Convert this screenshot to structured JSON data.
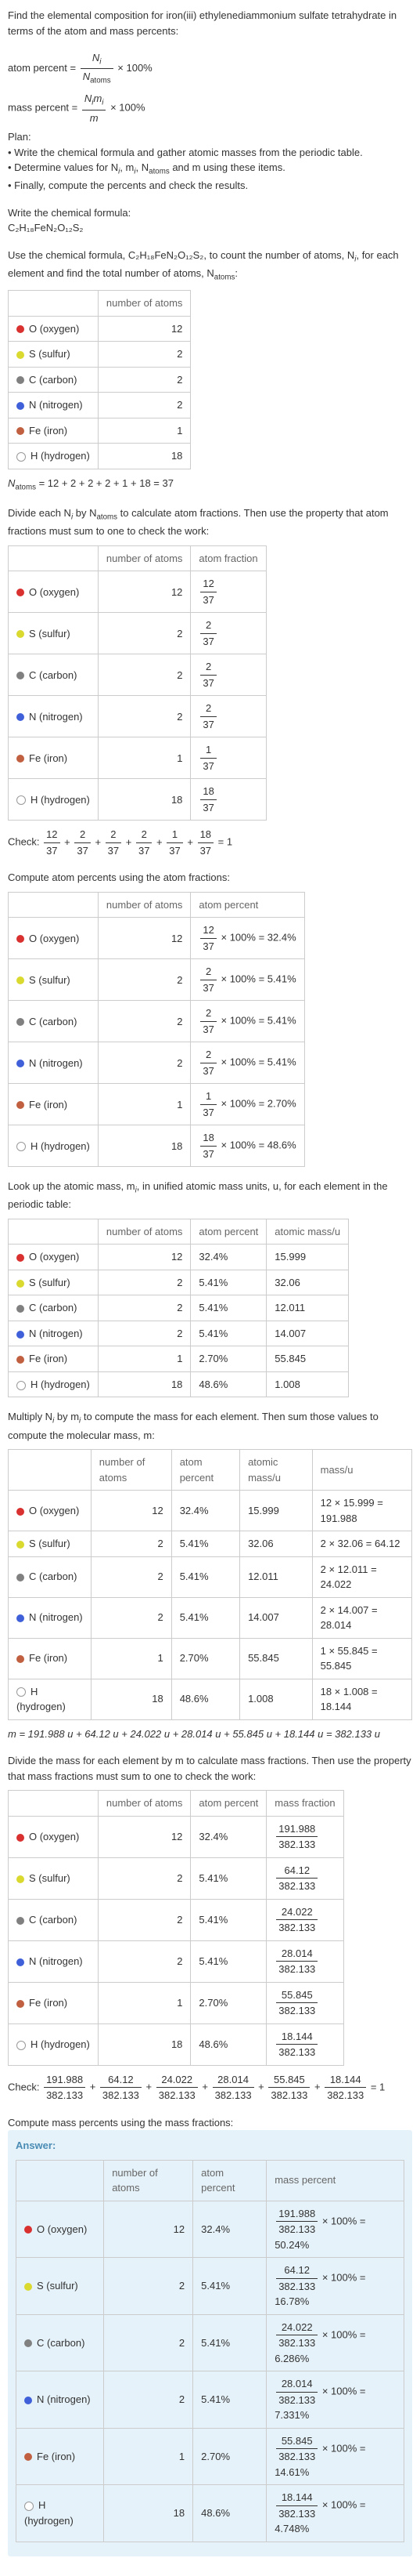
{
  "title": "Find the elemental composition for iron(iii) ethylenediammonium sulfate tetrahydrate in terms of the atom and mass percents:",
  "f1_label": "atom percent =",
  "f1_num": "N",
  "f1_num_sub": "i",
  "f1_den": "N",
  "f1_den_sub": "atoms",
  "times100": "× 100%",
  "f2_label": "mass percent =",
  "f2_num": "N",
  "f2_num_sub": "i",
  "f2_num2": "m",
  "f2_num2_sub": "i",
  "f2_den": "m",
  "plan_label": "Plan:",
  "plan1": "• Write the chemical formula and gather atomic masses from the periodic table.",
  "plan2": "• Determine values for N",
  "plan2b": ", m",
  "plan2c": ", N",
  "plan2d": " and m using these items.",
  "plan3": "• Finally, compute the percents and check the results.",
  "wc": "Write the chemical formula:",
  "cf": "C₂H₁₈FeN₂O₁₂S₂",
  "use": "Use the chemical formula, C₂H₁₈FeN₂O₁₂S₂, to count the number of atoms, N",
  "use2": ", for each element and find the total number of atoms, N",
  "use3": ":",
  "h_noa": "number of atoms",
  "h_af": "atom fraction",
  "h_ap": "atom percent",
  "h_am": "atomic mass/u",
  "h_mu": "mass/u",
  "h_mf": "mass fraction",
  "h_mp": "mass percent",
  "elements": [
    {
      "name": "O (oxygen)",
      "color": "#d93030",
      "n": "12",
      "af_n": "12",
      "af_d": "37",
      "ap": "32.4%",
      "ap_calc": "× 100% = 32.4%",
      "am": "15.999",
      "mu": "12 × 15.999 = 191.988",
      "mf_n": "191.988",
      "mf_d": "382.133",
      "mp_n": "191.988",
      "mp_d": "382.133",
      "mp": "× 100% = 50.24%"
    },
    {
      "name": "S (sulfur)",
      "color": "#d9d930",
      "n": "2",
      "af_n": "2",
      "af_d": "37",
      "ap": "5.41%",
      "ap_calc": "× 100% = 5.41%",
      "am": "32.06",
      "mu": "2 × 32.06 = 64.12",
      "mf_n": "64.12",
      "mf_d": "382.133",
      "mp_n": "64.12",
      "mp_d": "382.133",
      "mp": "× 100% = 16.78%"
    },
    {
      "name": "C (carbon)",
      "color": "#808080",
      "n": "2",
      "af_n": "2",
      "af_d": "37",
      "ap": "5.41%",
      "ap_calc": "× 100% = 5.41%",
      "am": "12.011",
      "mu": "2 × 12.011 = 24.022",
      "mf_n": "24.022",
      "mf_d": "382.133",
      "mp_n": "24.022",
      "mp_d": "382.133",
      "mp": "× 100% = 6.286%"
    },
    {
      "name": "N (nitrogen)",
      "color": "#4060d9",
      "n": "2",
      "af_n": "2",
      "af_d": "37",
      "ap": "5.41%",
      "ap_calc": "× 100% = 5.41%",
      "am": "14.007",
      "mu": "2 × 14.007 = 28.014",
      "mf_n": "28.014",
      "mf_d": "382.133",
      "mp_n": "28.014",
      "mp_d": "382.133",
      "mp": "× 100% = 7.331%"
    },
    {
      "name": "Fe (iron)",
      "color": "#c06040",
      "n": "1",
      "af_n": "1",
      "af_d": "37",
      "ap": "2.70%",
      "ap_calc": "× 100% = 2.70%",
      "am": "55.845",
      "mu": "1 × 55.845 = 55.845",
      "mf_n": "55.845",
      "mf_d": "382.133",
      "mp_n": "55.845",
      "mp_d": "382.133",
      "mp": "× 100% = 14.61%"
    },
    {
      "name": "H (hydrogen)",
      "color": "#ffffff",
      "n": "18",
      "af_n": "18",
      "af_d": "37",
      "ap": "48.6%",
      "ap_calc": "× 100% = 48.6%",
      "am": "1.008",
      "mu": "18 × 1.008 = 18.144",
      "mf_n": "18.144",
      "mf_d": "382.133",
      "mp_n": "18.144",
      "mp_d": "382.133",
      "mp": "× 100% = 4.748%"
    }
  ],
  "natoms": "N",
  "natoms_eq": " = 12 + 2 + 2 + 2 + 1 + 18 = 37",
  "divide": "Divide each N",
  "divide2": " by N",
  "divide3": " to calculate atom fractions. Then use the property that atom fractions must sum to one to check the work:",
  "check": "Check: ",
  "check_eq": " = 1",
  "cap_atoms": "Compute atom percents using the atom fractions:",
  "look": "Look up the atomic mass, m",
  "look2": ", in unified atomic mass units, u, for each element in the periodic table:",
  "mult": "Multiply N",
  "mult2": " by m",
  "mult3": " to compute the mass for each element. Then sum those values to compute the molecular mass, m:",
  "m_eq": "m = 191.988 u + 64.12 u + 24.022 u + 28.014 u + 55.845 u + 18.144 u = 382.133 u",
  "div_mass": "Divide the mass for each element by m to calculate mass fractions. Then use the property that mass fractions must sum to one to check the work:",
  "cmp": "Compute mass percents using the mass fractions:",
  "answer": "Answer:",
  "chart_data": {
    "type": "table",
    "tables": [
      {
        "title": "atom counts",
        "rows": [
          [
            "O (oxygen)",
            12
          ],
          [
            "S (sulfur)",
            2
          ],
          [
            "C (carbon)",
            2
          ],
          [
            "N (nitrogen)",
            2
          ],
          [
            "Fe (iron)",
            1
          ],
          [
            "H (hydrogen)",
            18
          ]
        ],
        "N_atoms": 37
      },
      {
        "title": "atom fractions",
        "rows": [
          [
            "O",
            "12/37"
          ],
          [
            "S",
            "2/37"
          ],
          [
            "C",
            "2/37"
          ],
          [
            "N",
            "2/37"
          ],
          [
            "Fe",
            "1/37"
          ],
          [
            "H",
            "18/37"
          ]
        ]
      },
      {
        "title": "atom percents",
        "rows": [
          [
            "O",
            32.4
          ],
          [
            "S",
            5.41
          ],
          [
            "C",
            5.41
          ],
          [
            "N",
            5.41
          ],
          [
            "Fe",
            2.7
          ],
          [
            "H",
            48.6
          ]
        ]
      },
      {
        "title": "atomic mass/u",
        "rows": [
          [
            "O",
            15.999
          ],
          [
            "S",
            32.06
          ],
          [
            "C",
            12.011
          ],
          [
            "N",
            14.007
          ],
          [
            "Fe",
            55.845
          ],
          [
            "H",
            1.008
          ]
        ]
      },
      {
        "title": "mass/u",
        "rows": [
          [
            "O",
            191.988
          ],
          [
            "S",
            64.12
          ],
          [
            "C",
            24.022
          ],
          [
            "N",
            28.014
          ],
          [
            "Fe",
            55.845
          ],
          [
            "H",
            18.144
          ]
        ],
        "m": 382.133
      },
      {
        "title": "mass fractions",
        "rows": [
          [
            "O",
            "191.988/382.133"
          ],
          [
            "S",
            "64.12/382.133"
          ],
          [
            "C",
            "24.022/382.133"
          ],
          [
            "N",
            "28.014/382.133"
          ],
          [
            "Fe",
            "55.845/382.133"
          ],
          [
            "H",
            "18.144/382.133"
          ]
        ]
      },
      {
        "title": "mass percents",
        "rows": [
          [
            "O",
            50.24
          ],
          [
            "S",
            16.78
          ],
          [
            "C",
            6.286
          ],
          [
            "N",
            7.331
          ],
          [
            "Fe",
            14.61
          ],
          [
            "H",
            4.748
          ]
        ]
      }
    ]
  }
}
